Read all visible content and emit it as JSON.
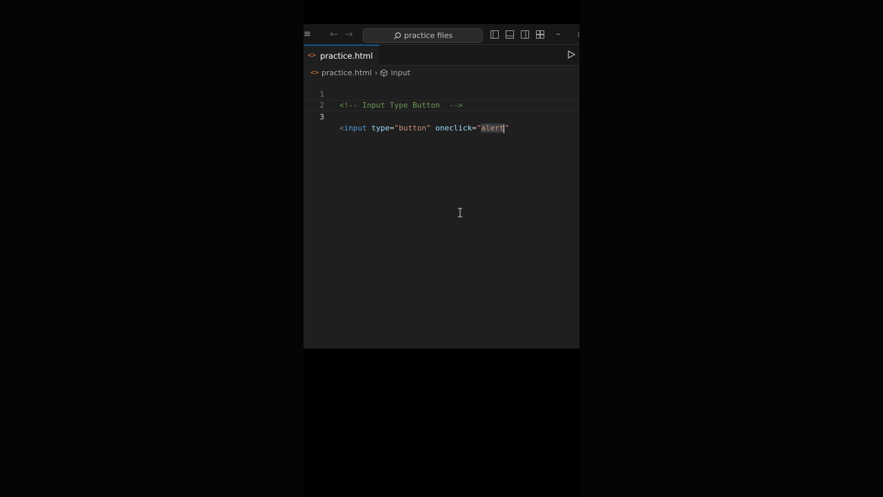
{
  "titlebar": {
    "search_text": "practice files"
  },
  "tab": {
    "label": "practice.html",
    "icon": "html-file-icon"
  },
  "breadcrumb": {
    "file": "practice.html",
    "separator": "›",
    "symbol": "input"
  },
  "editor": {
    "line_numbers": [
      "1",
      "2",
      "3"
    ],
    "line1": {
      "comment": "<!-- Input Type Button  -->"
    },
    "line3": {
      "open_bracket": "<",
      "tag": "input",
      "attr1_name": "type",
      "eq": "=",
      "attr1_value": "\"button\"",
      "attr2_name": "oneclick",
      "quote_open": "\"",
      "selected_text": "alert",
      "quote_close": "\""
    }
  },
  "colors": {
    "background": "#000000",
    "editor_bg": "#1f1f1f",
    "accent": "#0078d4",
    "html_icon": "#e37933"
  }
}
